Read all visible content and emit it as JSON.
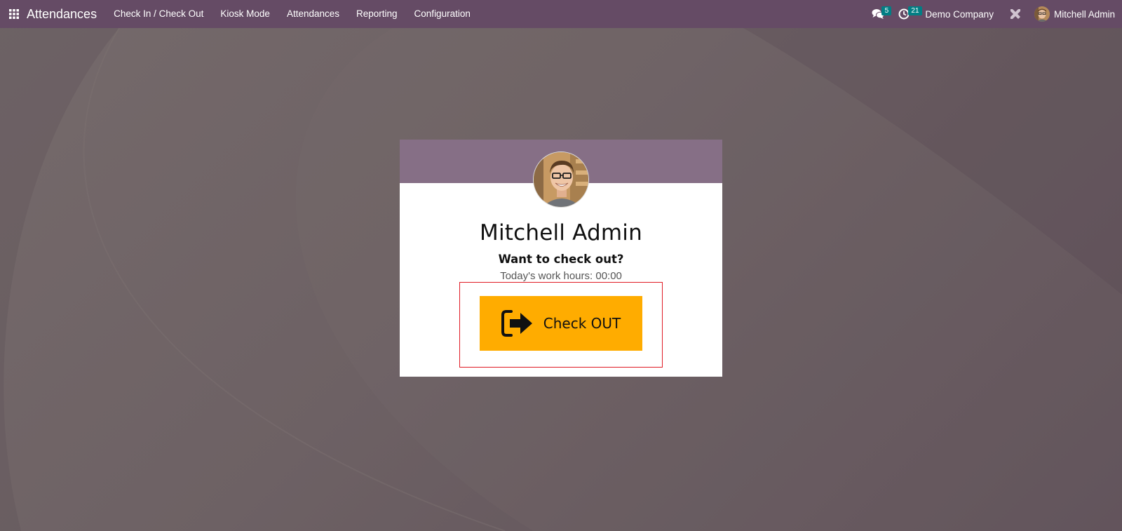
{
  "navbar": {
    "app_name": "Attendances",
    "menu": [
      {
        "label": "Check In / Check Out"
      },
      {
        "label": "Kiosk Mode"
      },
      {
        "label": "Attendances"
      },
      {
        "label": "Reporting"
      },
      {
        "label": "Configuration"
      }
    ],
    "messages_count": "5",
    "activities_count": "21",
    "company": "Demo Company",
    "user_name": "Mitchell Admin",
    "icons": [
      "apps-grid-icon",
      "chat-icon",
      "clock-icon",
      "debug-tools-icon",
      "user-avatar"
    ]
  },
  "card": {
    "employee_name": "Mitchell Admin",
    "question": "Want to check out?",
    "work_hours_text": "Today's work hours: 00:00",
    "button_label": "Check OUT",
    "button_icon": "sign-out-icon"
  },
  "colors": {
    "navbar": "#654b65",
    "card_header": "#866f86",
    "button": "#ffac00",
    "badge": "#017e84",
    "highlight": "#e01b24"
  }
}
